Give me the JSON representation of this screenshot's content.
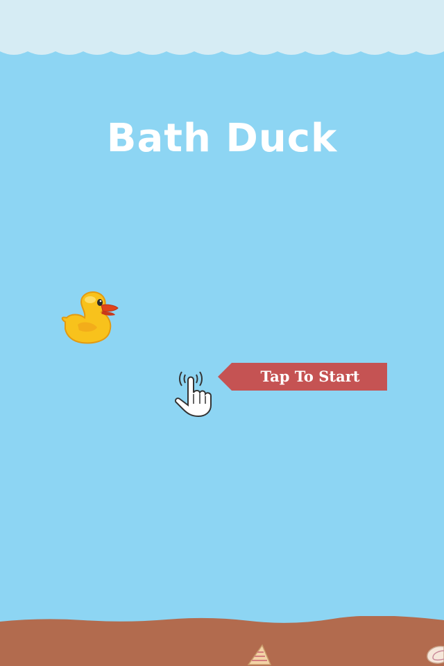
{
  "game": {
    "title": "Bath Duck",
    "start_prompt": "Tap To Start"
  },
  "icons": {
    "player": "rubber-duck-icon",
    "hint": "tap-hand-icon",
    "decorations": [
      "cone-shell-icon",
      "spiral-shell-icon"
    ]
  },
  "colors": {
    "water": "#8dd5f3",
    "foam": "#d6ecf4",
    "ground": "#b26b4e",
    "banner": "#c55353",
    "title": "#ffffff",
    "duck": "#f8c21c",
    "beak": "#e0451b"
  }
}
